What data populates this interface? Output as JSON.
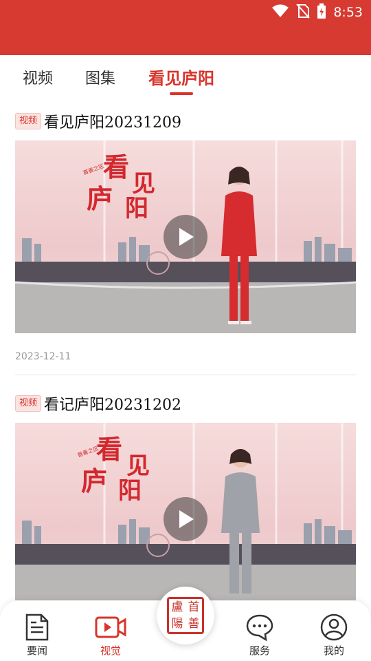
{
  "status_bar": {
    "time": "8:53",
    "icons": [
      "wifi-icon",
      "no-sim-icon",
      "battery-charging-icon"
    ],
    "color": "#d73a31"
  },
  "tabs": [
    {
      "label": "视频",
      "active": false
    },
    {
      "label": "图集",
      "active": false
    },
    {
      "label": "看见庐阳",
      "active": true
    }
  ],
  "accent_color": "#d9342b",
  "feed": [
    {
      "badge": "视频",
      "title": "看见庐阳20231209",
      "date": "2023-12-11",
      "thumbnail": {
        "logo_lines": [
          "看",
          "见",
          "庐",
          "阳"
        ],
        "logo_small": "首善之区",
        "presenter_outfit": "red-suit"
      }
    },
    {
      "badge": "视频",
      "title": "看记庐阳20231202",
      "date": "",
      "thumbnail": {
        "logo_lines": [
          "看",
          "见",
          "庐",
          "阳"
        ],
        "logo_small": "首善之区",
        "presenter_outfit": "grey-suit"
      }
    }
  ],
  "bottom_nav": {
    "items": [
      {
        "label": "要闻",
        "icon": "news-document-icon",
        "active": false
      },
      {
        "label": "视觉",
        "icon": "video-camera-icon",
        "active": true
      },
      {
        "label": "服务",
        "icon": "chat-bubble-icon",
        "active": false
      },
      {
        "label": "我的",
        "icon": "user-profile-icon",
        "active": false
      }
    ],
    "center_logo": [
      "盧",
      "首",
      "陽",
      "善"
    ]
  }
}
